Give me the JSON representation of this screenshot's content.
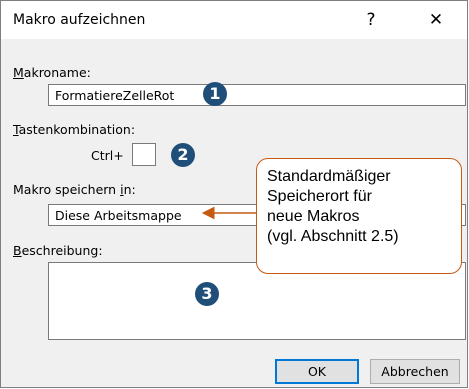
{
  "dialog": {
    "title": "Makro aufzeichnen",
    "help_symbol": "?",
    "close_symbol": "✕"
  },
  "macro_name": {
    "label_underlined": "M",
    "label_rest": "akroname:",
    "value": "FormatiereZelleRot"
  },
  "shortcut": {
    "label_underlined": "T",
    "label_rest": "astenkombination:",
    "prefix": "Ctrl+",
    "value": ""
  },
  "store_in": {
    "label_pre": "Makro speichern ",
    "label_underlined": "i",
    "label_post": "n:",
    "selected": "Diese Arbeitsmappe"
  },
  "description": {
    "label_underlined": "B",
    "label_rest": "eschreibung:",
    "value": ""
  },
  "badges": [
    "1",
    "2",
    "3"
  ],
  "callout": {
    "lines": [
      "Standardmäßiger",
      "Speicherort für",
      "neue Makros",
      "(vgl. Abschnitt 2.5)"
    ]
  },
  "buttons": {
    "ok": "OK",
    "cancel": "Abbrechen"
  },
  "colors": {
    "badge": "#1f4e79",
    "callout_border": "#c55a11",
    "default_button_border": "#0078d7"
  }
}
